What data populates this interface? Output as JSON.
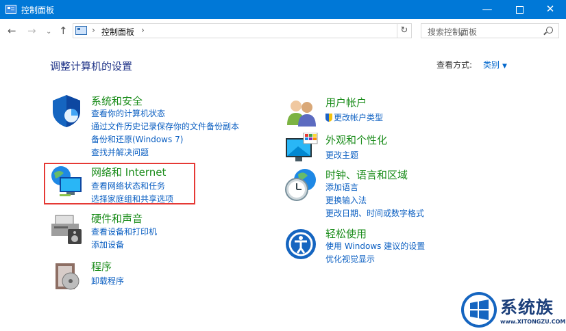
{
  "window": {
    "title": "控制面板"
  },
  "address": {
    "crumb": "控制面板"
  },
  "search": {
    "placeholder": "搜索控制面板"
  },
  "page_title": "调整计算机的设置",
  "view_by": {
    "label": "查看方式:",
    "value": "类别"
  },
  "categories": [
    {
      "title": "系统和安全",
      "links": [
        "查看你的计算机状态",
        "通过文件历史记录保存你的文件备份副本",
        "备份和还原(Windows 7)",
        "查找并解决问题"
      ]
    },
    {
      "title": "网络和 Internet",
      "links": [
        "查看网络状态和任务",
        "选择家庭组和共享选项"
      ]
    },
    {
      "title": "硬件和声音",
      "links": [
        "查看设备和打印机",
        "添加设备"
      ]
    },
    {
      "title": "程序",
      "links": [
        "卸载程序"
      ]
    },
    {
      "title": "用户帐户",
      "links": [
        "更改帐户类型"
      ]
    },
    {
      "title": "外观和个性化",
      "links": [
        "更改主题"
      ]
    },
    {
      "title": "时钟、语言和区域",
      "links": [
        "添加语言",
        "更换输入法",
        "更改日期、时间或数字格式"
      ]
    },
    {
      "title": "轻松使用",
      "links": [
        "使用 Windows 建议的设置",
        "优化视觉显示"
      ]
    }
  ],
  "watermark": {
    "name": "系统族",
    "url": "www.XITONGZU.COM"
  },
  "colors": {
    "titlebar": "#0078d7",
    "category_heading": "#1a8c1a",
    "link": "#0b5fc2",
    "highlight_box": "#e53935"
  }
}
